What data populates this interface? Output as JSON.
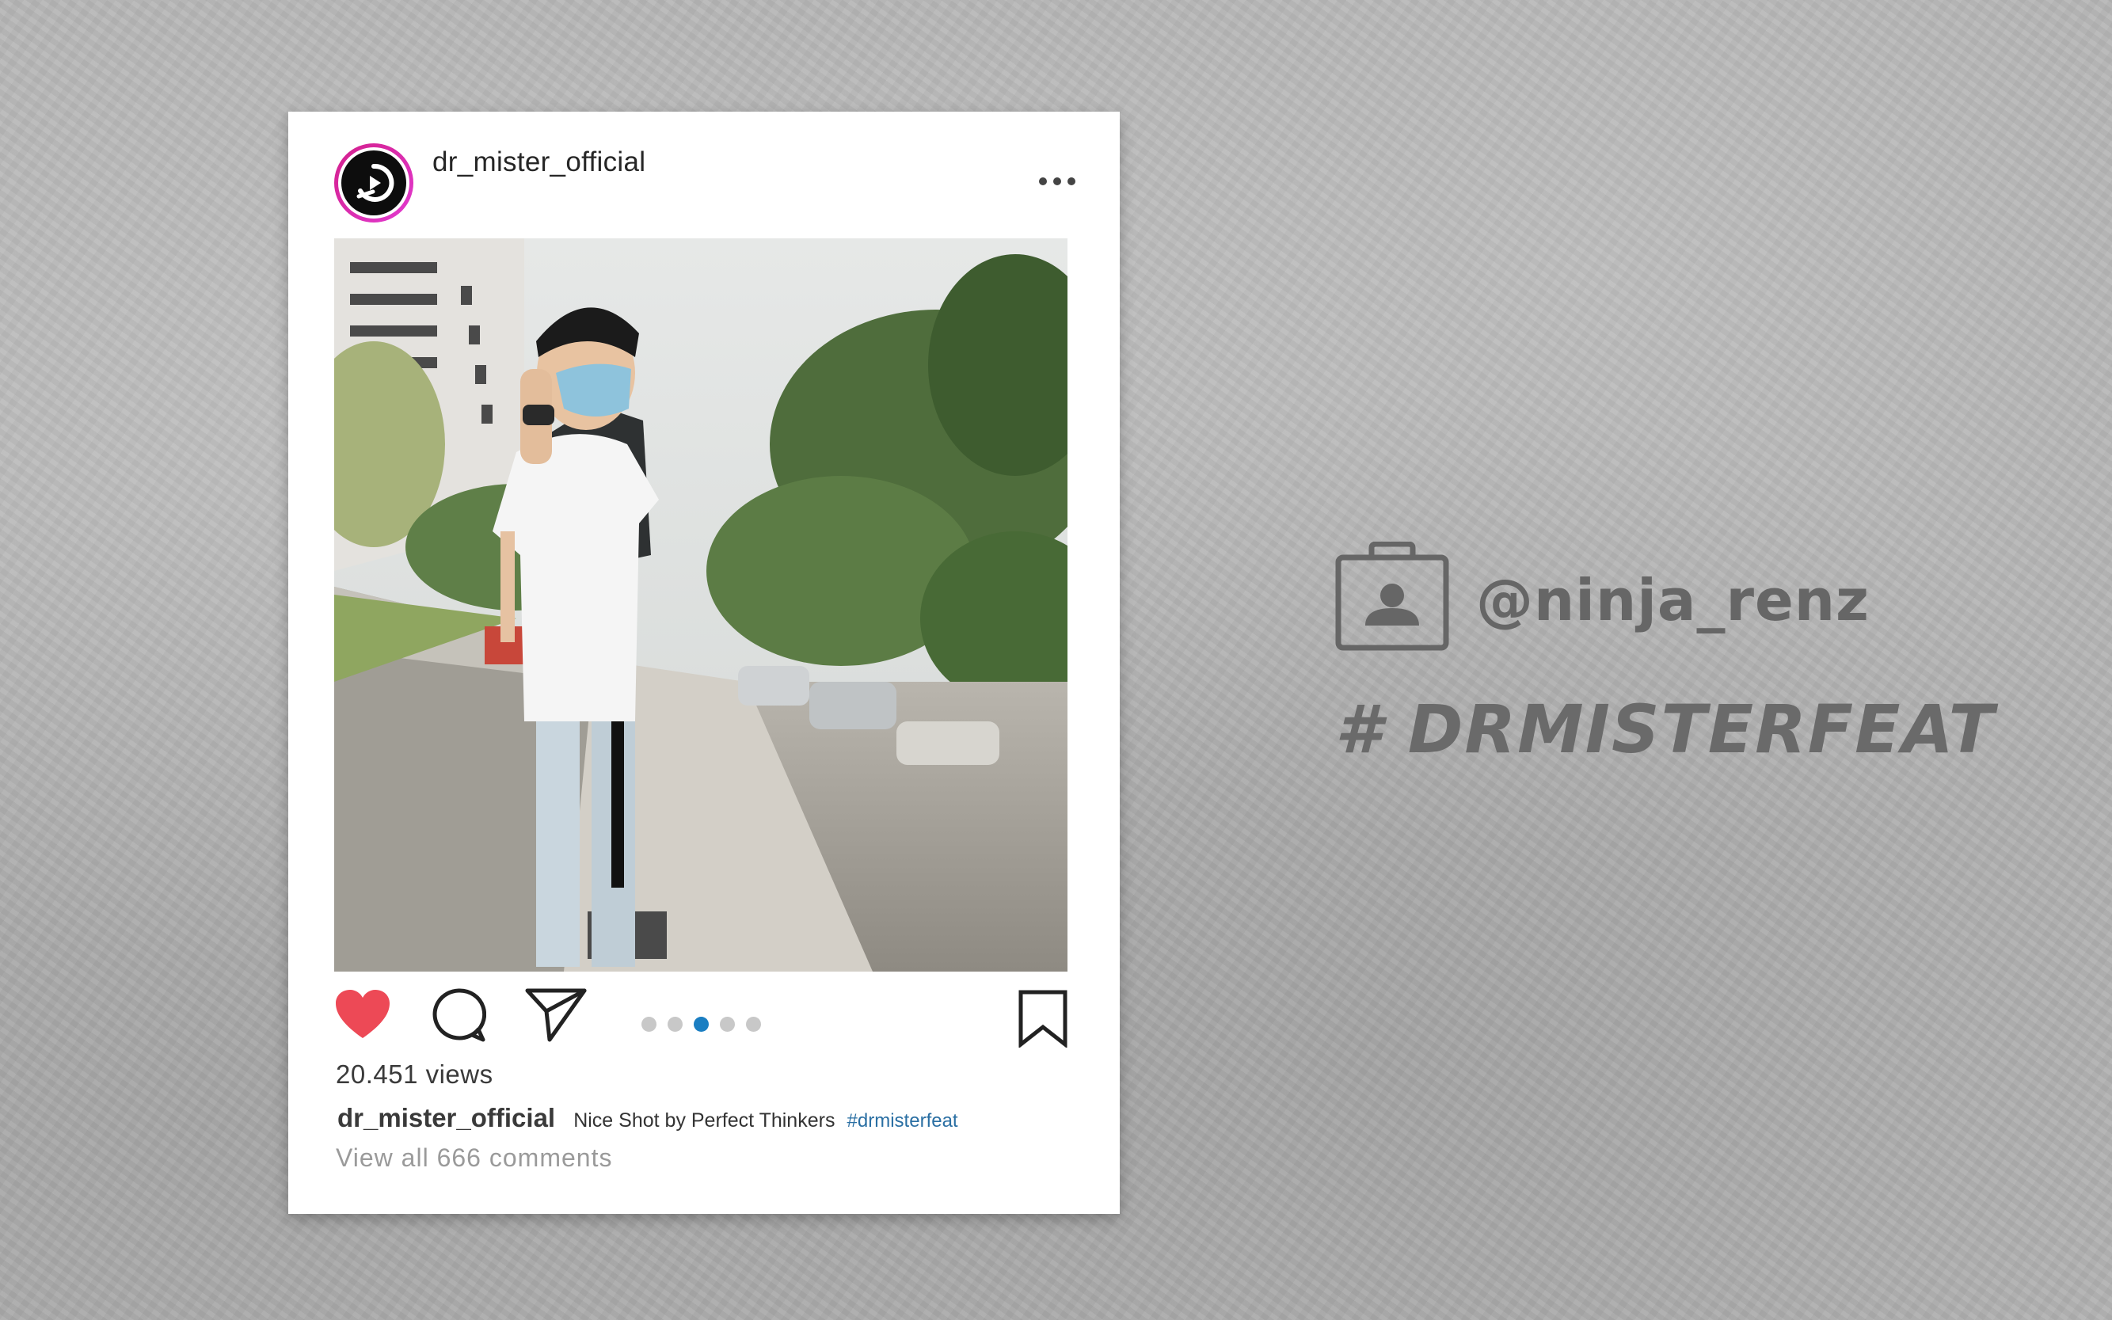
{
  "post": {
    "username": "dr_mister_official",
    "views": "20.451 views",
    "caption_user": "dr_mister_official",
    "caption_text": "Nice Shot by Perfect Thinkers",
    "caption_hashtag": "#drmisterfeat",
    "comments_link": "View all 666 comments",
    "carousel": {
      "count": 5,
      "active_index": 2
    },
    "liked": true
  },
  "icons": {
    "more": "more-horizontal-icon",
    "like": "heart-icon",
    "comment": "comment-bubble-icon",
    "share": "paper-plane-icon",
    "save": "bookmark-icon",
    "profile": "id-badge-icon"
  },
  "colors": {
    "like_red": "#ed4956",
    "carousel_active": "#1a7ec2",
    "hashtag_link": "#2a6fa3",
    "avatar_ring": "#d31f8a"
  },
  "credits": {
    "handle": "@ninja_renz",
    "hashtag": "# DRMISTERFEAT"
  }
}
